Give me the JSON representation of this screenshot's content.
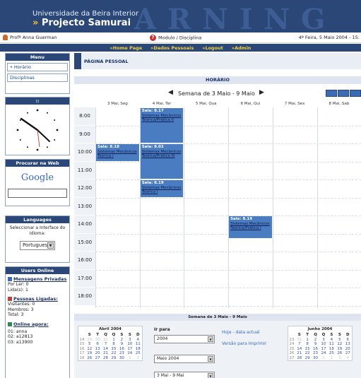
{
  "header": {
    "university": "Universidade da Beira Interior",
    "project_arrow": "»",
    "project": "Projecto Samurai",
    "watermark": "ARNING"
  },
  "userbar": {
    "user": "Profª Anna Guerman",
    "module": "Modulo / Disciplina",
    "date": "4ª Feira, 5 Maio 2004 - 15:"
  },
  "topnav": [
    "Home Page",
    "Dados Pessoais",
    "Logout",
    "Admin"
  ],
  "topnav_marker": "»",
  "menu": {
    "title": "Menu",
    "items": [
      "• Horário",
      "Disciplinas"
    ]
  },
  "clock": {
    "title": "::"
  },
  "search": {
    "title": "Procurar na Web",
    "logo": "Google"
  },
  "languages": {
    "title": "Languages",
    "label": "Seleccionar a Interface do Idioma:",
    "selected": "Portuguese"
  },
  "users_online": {
    "title": "Users Online",
    "messages_title": "Mensagens Privadas",
    "por_ler": "Por Ler: 0",
    "lidas": "Lida(s): 1",
    "connected_title": "Pessoas Ligadas:",
    "visitantes": "Visitantes: 0",
    "membros": "Membros: 3",
    "total": "Total: 3",
    "online_now_title": "Online agora:",
    "online_users": [
      "01: anna",
      "02: a12813",
      "03: a13900"
    ]
  },
  "main": {
    "page_title": "PÁGINA PESSOAL",
    "schedule_header": "HORÁRIO",
    "week_label": "Semana de 3 Maio - 9 Maio",
    "prev_arrow": "◀",
    "next_arrow": "▶",
    "days": [
      "3 Mai, Seg",
      "4 Mai, Ter",
      "5 Mai, Qua",
      "6 Mai, Qui",
      "7 Mai, Sex",
      "8 Mai, Sab"
    ],
    "hours": [
      "8:00",
      "9:00",
      "10:00",
      "11:00",
      "12:00",
      "13:00",
      "14:00",
      "15:00",
      "16:00",
      "17:00",
      "18:00"
    ],
    "events": [
      {
        "day": 1,
        "start": 8,
        "end": 10,
        "room": "Sala: 8.17",
        "course": "Sistemas Mecânicos Teórica/Prática II"
      },
      {
        "day": 0,
        "start": 10,
        "end": 11,
        "room": "Sala: 8.18",
        "course": "Sistemas Mecânicos Teórica I"
      },
      {
        "day": 1,
        "start": 10,
        "end": 12,
        "room": "Sala: 8.02",
        "course": "Sistemas Mecânicos Teórica/Prática III"
      },
      {
        "day": 1,
        "start": 12,
        "end": 13,
        "room": "Sala: 8.19",
        "course": "Sistemas Mecânicos Teórica I"
      },
      {
        "day": 3,
        "start": 14,
        "end": 15.3,
        "room": "Sala: 8.19",
        "course": "Sistemas Mecânicos Teórica/Prática I"
      }
    ]
  },
  "bottom": {
    "header": "Semana de 3 Maio - 9 Maio",
    "cal_left_title": "Abril 2004",
    "cal_right_title": "Junho 2004",
    "dow": [
      "S",
      "T",
      "Q",
      "Q",
      "S",
      "S",
      "D"
    ],
    "april_weeks": [
      [
        "14",
        [
          "29",
          "30",
          "31",
          "1",
          "2",
          "3",
          "4"
        ]
      ],
      [
        "15",
        [
          "5",
          "6",
          "7",
          "8",
          "9",
          "10",
          "11"
        ]
      ],
      [
        "16",
        [
          "12",
          "13",
          "14",
          "15",
          "16",
          "17",
          "18"
        ]
      ],
      [
        "17",
        [
          "19",
          "20",
          "21",
          "22",
          "23",
          "24",
          "25"
        ]
      ],
      [
        "18",
        [
          "26",
          "27",
          "28",
          "29",
          "30",
          "1",
          "2"
        ]
      ]
    ],
    "june_weeks": [
      [
        "23",
        [
          "31",
          "1",
          "2",
          "3",
          "4",
          "5",
          "6"
        ]
      ],
      [
        "24",
        [
          "7",
          "8",
          "9",
          "10",
          "11",
          "12",
          "13"
        ]
      ],
      [
        "25",
        [
          "14",
          "15",
          "16",
          "17",
          "18",
          "19",
          "20"
        ]
      ],
      [
        "26",
        [
          "21",
          "22",
          "23",
          "24",
          "25",
          "26",
          "27"
        ]
      ],
      [
        "27",
        [
          "28",
          "29",
          "30",
          "1",
          "2",
          "3",
          "4"
        ]
      ]
    ],
    "ir_para": "Ir para",
    "year_value": "2004",
    "month_value": "Maio 2004",
    "week_value": "3 Mai - 9 Mai",
    "today_link": "Hoje - data actual",
    "print_link": "Versão para Imprimir"
  }
}
